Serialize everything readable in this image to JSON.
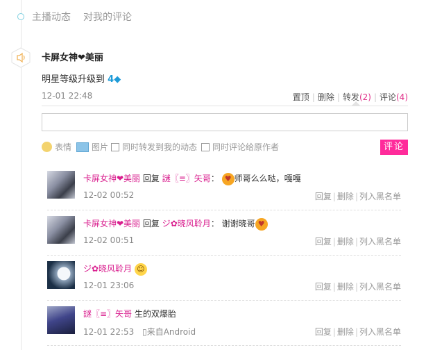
{
  "tabs": [
    "主播动态",
    "对我的评论"
  ],
  "post": {
    "author": "卡屏女神❤美丽",
    "content_prefix": "明星等级升级到",
    "level": "4",
    "time": "12-01 22:48",
    "actions": {
      "pin": "置顶",
      "delete": "删除",
      "forward": "转发",
      "forward_count": "(2)",
      "comment": "评论",
      "comment_count": "(4)"
    }
  },
  "editor": {
    "emoji_label": "表情",
    "image_label": "图片",
    "option1": "同时转发到我的动态",
    "option2": "同时评论给原作者",
    "submit": "评论"
  },
  "comments": [
    {
      "author": "卡屏女神❤美丽",
      "reply_word": "回复",
      "target": "謎〖≡〗矢哥",
      "colon": "：",
      "text": "师哥么么哒，嘎嘎",
      "time": "12-02 00:52",
      "actions": [
        "回复",
        "删除",
        "列入黑名单"
      ]
    },
    {
      "author": "卡屏女神❤美丽",
      "reply_word": "回复",
      "target": "ジ✿晓风聆月",
      "colon": "：",
      "text": "谢谢晓哥",
      "time": "12-02 00:51",
      "actions": [
        "回复",
        "删除",
        "列入黑名单"
      ]
    },
    {
      "author": "ジ✿晓风聆月",
      "time": "12-01 23:06",
      "actions": [
        "回复",
        "删除",
        "列入黑名单"
      ]
    },
    {
      "author": "謎〖≡〗矢哥",
      "text": "生的双爆胎",
      "time": "12-01 22:53",
      "from": "来自Android",
      "actions": [
        "回复",
        "删除",
        "列入黑名单"
      ]
    }
  ]
}
